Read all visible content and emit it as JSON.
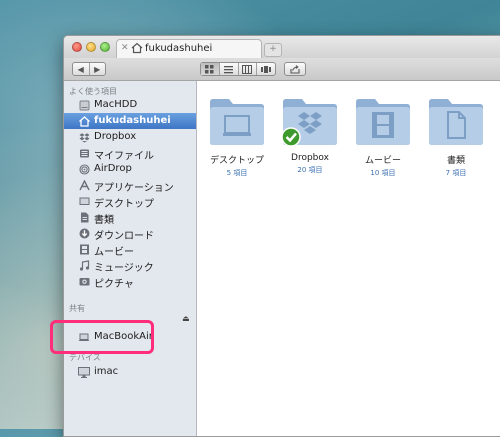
{
  "tab": {
    "title": "fukudashuhei",
    "new_tab": "+"
  },
  "toolbar": {
    "back": "◀",
    "forward": "▶"
  },
  "sidebar": {
    "favorites_header": "よく使う項目",
    "favorites": [
      {
        "label": "MacHDD",
        "icon": "disk-icon"
      },
      {
        "label": "fukudashuhei",
        "icon": "home-icon",
        "selected": true
      },
      {
        "label": "Dropbox",
        "icon": "dropbox-icon"
      },
      {
        "label": "マイファイル",
        "icon": "all-files-icon"
      },
      {
        "label": "AirDrop",
        "icon": "airdrop-icon"
      },
      {
        "label": "アプリケーション",
        "icon": "applications-icon"
      },
      {
        "label": "デスクトップ",
        "icon": "desktop-icon"
      },
      {
        "label": "書類",
        "icon": "documents-icon"
      },
      {
        "label": "ダウンロード",
        "icon": "downloads-icon"
      },
      {
        "label": "ムービー",
        "icon": "movies-icon"
      },
      {
        "label": "ミュージック",
        "icon": "music-icon"
      },
      {
        "label": "ピクチャ",
        "icon": "pictures-icon"
      }
    ],
    "shared_header": "共有",
    "shared": [
      {
        "label": "MacBookAir",
        "icon": "laptop-icon"
      }
    ],
    "devices_header": "デバイス",
    "devices": [
      {
        "label": "imac",
        "icon": "imac-icon"
      }
    ]
  },
  "folders": [
    {
      "name": "デスクトップ",
      "count": "5 項目",
      "badge": "desktop"
    },
    {
      "name": "Dropbox",
      "count": "20 項目",
      "badge": "dropbox"
    },
    {
      "name": "ムービー",
      "count": "10 項目",
      "badge": "film"
    },
    {
      "name": "書類",
      "count": "7 項目",
      "badge": "document"
    }
  ],
  "colors": {
    "selection": "#3e76c6",
    "folder": "#9dbad8",
    "highlight": "#ff2d7a",
    "count_text": "#3a6fb0"
  }
}
